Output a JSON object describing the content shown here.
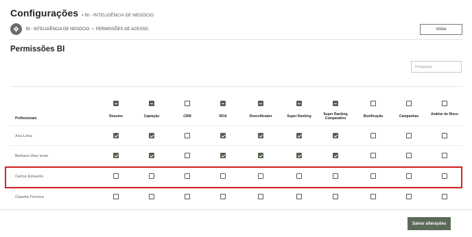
{
  "header": {
    "title": "Configurações",
    "subtitle": "> BI - INTELIGÊNCIA DE NEGÓCIO"
  },
  "breadcrumb": {
    "icon": "gear-icon",
    "items": [
      "BI - INTELIGÊNCIA DE NEGÓCIO",
      "PERMISSÕES DE ACESSO"
    ],
    "separator": ">"
  },
  "actions": {
    "back_label": "Voltar",
    "save_label": "Salvar alterações"
  },
  "section": {
    "title": "Permissões BI"
  },
  "search": {
    "placeholder": "Pesquisar",
    "value": ""
  },
  "table": {
    "professionals_header": "Profissionais",
    "columns": [
      {
        "label": "Resumo",
        "header_state": "indeterminate"
      },
      {
        "label": "Captação",
        "header_state": "indeterminate"
      },
      {
        "label": "CRM",
        "header_state": "unchecked"
      },
      {
        "label": "ROA",
        "header_state": "indeterminate"
      },
      {
        "label": "Diversificador",
        "header_state": "indeterminate"
      },
      {
        "label": "Super Ranking",
        "header_state": "indeterminate"
      },
      {
        "label": "Super Ranking Comparativo",
        "header_state": "indeterminate"
      },
      {
        "label": "Bonificação",
        "header_state": "unchecked"
      },
      {
        "label": "Campanhas",
        "header_state": "unchecked"
      },
      {
        "label": "Análise de Risco",
        "header_state": "unchecked"
      }
    ],
    "rows": [
      {
        "name": "Ana Lima",
        "permissions": [
          true,
          true,
          false,
          true,
          true,
          true,
          true,
          false,
          false,
          false
        ]
      },
      {
        "name": "Barbara Dias teste",
        "permissions": [
          true,
          true,
          false,
          true,
          true,
          true,
          true,
          false,
          false,
          false
        ]
      },
      {
        "name": "Carlos Eduardo",
        "permissions": [
          false,
          false,
          false,
          false,
          false,
          false,
          false,
          false,
          false,
          false
        ],
        "highlighted": true
      },
      {
        "name": "Claudia Ferreira",
        "permissions": [
          false,
          false,
          false,
          false,
          false,
          false,
          false,
          false,
          false,
          false
        ]
      }
    ]
  },
  "colors": {
    "accent": "#55614f",
    "save_button": "#5c6a58",
    "highlight": "#d62020"
  }
}
